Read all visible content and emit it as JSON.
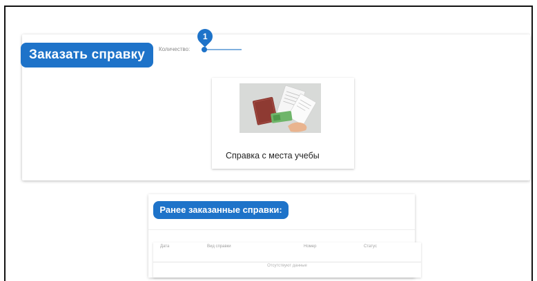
{
  "order": {
    "title": "Заказать справку",
    "quantity_label": "Количество:",
    "quantity_value": "1"
  },
  "certificate_card": {
    "title": "Справка с места учебы",
    "image_icon": "documents-illustration-icon"
  },
  "history": {
    "title": "Ранее заказанные справки:",
    "columns": [
      "Дата",
      "Вид справки",
      "Номер",
      "Статус"
    ],
    "empty_text": "Отсутствуют данные"
  },
  "colors": {
    "accent": "#1e73c9",
    "card": "#ffffff"
  }
}
